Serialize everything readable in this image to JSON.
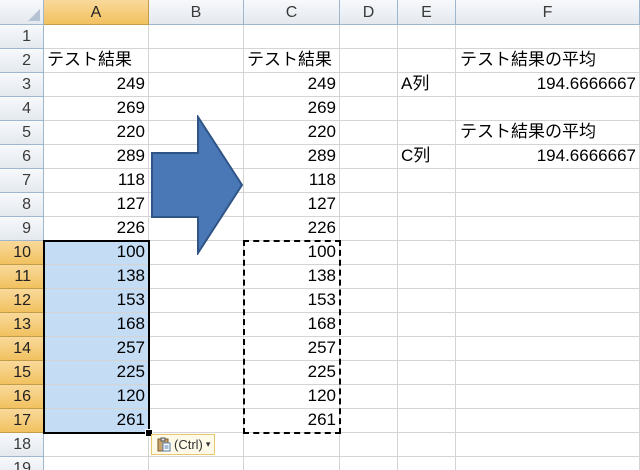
{
  "columns": [
    "A",
    "B",
    "C",
    "D",
    "E",
    "F"
  ],
  "rows": [
    "1",
    "2",
    "3",
    "4",
    "5",
    "6",
    "7",
    "8",
    "9",
    "10",
    "11",
    "12",
    "13",
    "14",
    "15",
    "16",
    "17",
    "18",
    "19"
  ],
  "selected_rows": [
    "10",
    "11",
    "12",
    "13",
    "14",
    "15",
    "16",
    "17"
  ],
  "selected_column": "A",
  "column_a": {
    "header": "テスト結果",
    "values": [
      "249",
      "269",
      "220",
      "289",
      "118",
      "127",
      "226",
      "100",
      "138",
      "153",
      "168",
      "257",
      "225",
      "120",
      "261"
    ]
  },
  "column_c": {
    "header": "テスト結果",
    "values": [
      "249",
      "269",
      "220",
      "289",
      "118",
      "127",
      "226",
      "100",
      "138",
      "153",
      "168",
      "257",
      "225",
      "120",
      "261"
    ]
  },
  "summary": {
    "label_a_title": "テスト結果の平均",
    "label_a": "A列",
    "value_a": "194.6666667",
    "label_c_title": "テスト結果の平均",
    "label_c": "C列",
    "value_c": "194.6666667"
  },
  "paste_options": {
    "label": "(Ctrl)",
    "icon": "paste-clipboard-icon"
  },
  "arrow": {
    "icon": "right-arrow-icon",
    "color": "#4a78b7"
  },
  "colors": {
    "selection": "#c5dcf5",
    "header_selected": "#f1c15f"
  }
}
